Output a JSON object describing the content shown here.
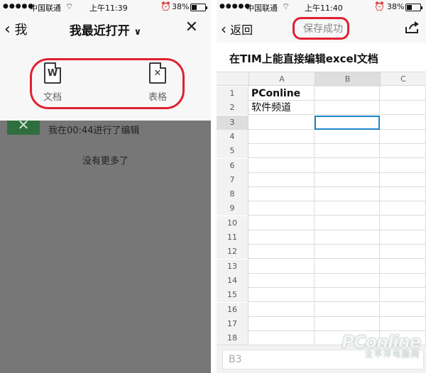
{
  "left": {
    "status": {
      "carrier": "中国联通",
      "time": "上午11:39",
      "battery": "38%",
      "battery_level": 0.38
    },
    "nav": {
      "back": "我",
      "title": "我最近打开"
    },
    "create": {
      "doc_label": "文档",
      "sheet_label": "表格"
    },
    "recent": {
      "text": "我在00:44进行了编辑"
    },
    "empty": {
      "text": "没有更多了"
    }
  },
  "right": {
    "status": {
      "carrier": "中国联通",
      "time": "上午11:40",
      "battery": "38%",
      "battery_level": 0.38
    },
    "nav": {
      "back": "返回",
      "status": "保存成功"
    },
    "doc_title": "在TIM上能直接编辑excel文档",
    "sheet": {
      "columns": [
        "A",
        "B",
        "C"
      ],
      "selected_column": "B",
      "rows": [
        "1",
        "2",
        "3",
        "4",
        "5",
        "6",
        "7",
        "8",
        "9",
        "10",
        "11",
        "12",
        "13",
        "14",
        "15",
        "16",
        "17",
        "18"
      ],
      "selected_row": "3",
      "cells": {
        "A1": "PConline",
        "A2": "软件频道"
      }
    },
    "formula": {
      "cell_ref": "B3"
    }
  },
  "watermark": {
    "line1": "PConline",
    "line2": "太平洋电脑网"
  },
  "colors": {
    "highlight_ring": "#e02030",
    "active_cell": "#1d87c9",
    "overlay": "#777777",
    "excel_green": "#2f6f3f"
  }
}
